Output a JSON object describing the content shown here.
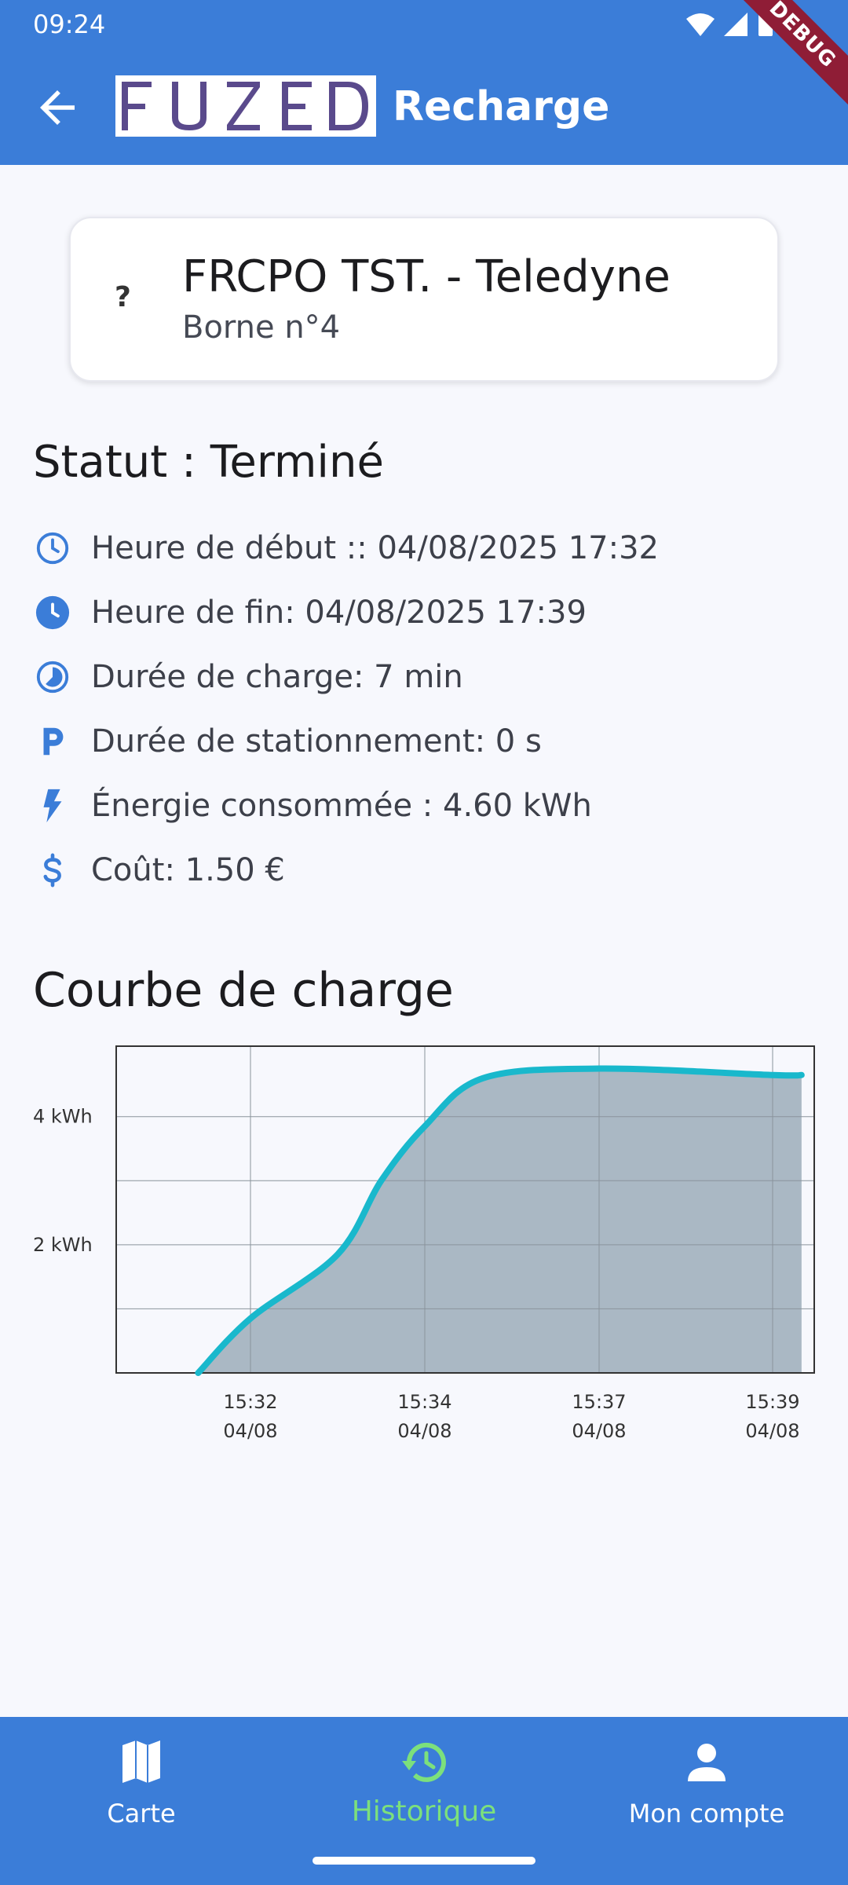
{
  "status_bar": {
    "time": "09:24",
    "debug_label": "DEBUG"
  },
  "app_bar": {
    "logo_text": "FUZED",
    "title": "Recharge"
  },
  "station": {
    "icon_text": "?",
    "name": "FRCPO TST. - Teledyne",
    "subtitle": "Borne n°4"
  },
  "status": {
    "title": "Statut : Terminé"
  },
  "details": [
    {
      "icon": "clock-outline-icon",
      "text": "Heure de début :: 04/08/2025 17:32"
    },
    {
      "icon": "clock-filled-icon",
      "text": "Heure de fin: 04/08/2025 17:39"
    },
    {
      "icon": "timelapse-icon",
      "text": "Durée de charge: 7 min"
    },
    {
      "icon": "parking-icon",
      "text": "Durée de stationnement: 0 s"
    },
    {
      "icon": "bolt-icon",
      "text": "Énergie consommée : 4.60 kWh"
    },
    {
      "icon": "dollar-icon",
      "text": "Coût: 1.50 €"
    }
  ],
  "curve_title": "Courbe de charge",
  "chart_data": {
    "type": "area",
    "title": "",
    "xlabel": "",
    "ylabel": "",
    "y_unit": "kWh",
    "y_ticks": [
      2,
      4
    ],
    "y_tick_labels": [
      "2 kWh",
      "4 kWh"
    ],
    "ylim": [
      0,
      5.1
    ],
    "x_tick_labels": [
      {
        "time": "15:32",
        "date": "04/08"
      },
      {
        "time": "15:34",
        "date": "04/08"
      },
      {
        "time": "15:37",
        "date": "04/08"
      },
      {
        "time": "15:39",
        "date": "04/08"
      }
    ],
    "grid": true,
    "series": [
      {
        "color": "#19b8cc",
        "fill": "#aab8c4",
        "points": [
          {
            "t": "15:31:24",
            "y": 0.0
          },
          {
            "t": "15:32:00",
            "y": 0.85
          },
          {
            "t": "15:33:00",
            "y": 1.85
          },
          {
            "t": "15:33:30",
            "y": 3.0
          },
          {
            "t": "15:34:00",
            "y": 3.85
          },
          {
            "t": "15:35:00",
            "y": 4.6
          },
          {
            "t": "15:37:00",
            "y": 4.75
          },
          {
            "t": "15:39:00",
            "y": 4.65
          },
          {
            "t": "15:39:20",
            "y": 4.65
          }
        ]
      }
    ]
  },
  "bottom_nav": [
    {
      "label": "Carte",
      "icon": "map-icon",
      "active": false
    },
    {
      "label": "Historique",
      "icon": "history-icon",
      "active": true
    },
    {
      "label": "Mon compte",
      "icon": "account-icon",
      "active": false
    }
  ],
  "colors": {
    "primary": "#3b7dd8",
    "accent": "#7ce07c",
    "curve": "#19b8cc",
    "icon": "#3b7dd8"
  }
}
